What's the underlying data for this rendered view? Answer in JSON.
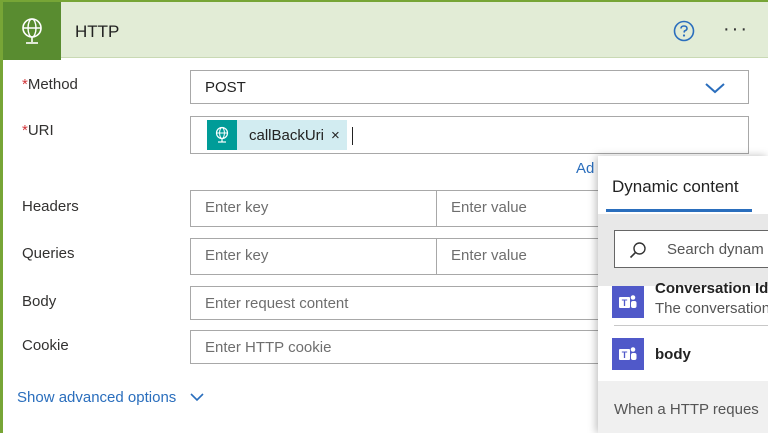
{
  "action": {
    "title": "HTTP",
    "icons": {
      "action": "globe-icon",
      "help": "help-circle-icon",
      "more": "more-options-icon"
    }
  },
  "form": {
    "required_mark": "*",
    "method": {
      "label": "Method",
      "value": "POST"
    },
    "uri": {
      "label": "URI",
      "token_label": "callBackUri",
      "token_close": "×"
    },
    "add_link": "Ad",
    "headers": {
      "label": "Headers",
      "key_placeholder": "Enter key",
      "value_placeholder": "Enter value"
    },
    "queries": {
      "label": "Queries",
      "key_placeholder": "Enter key",
      "value_placeholder": "Enter value"
    },
    "body": {
      "label": "Body",
      "placeholder": "Enter request content"
    },
    "cookie": {
      "label": "Cookie",
      "placeholder": "Enter HTTP cookie"
    },
    "advanced_link": "Show advanced options"
  },
  "dynamic_panel": {
    "title": "Dynamic content",
    "search_placeholder": "Search dynam",
    "items": [
      {
        "title": "Conversation Id",
        "description": "The conversation",
        "icon": "teams-icon"
      },
      {
        "title": "body",
        "description": "",
        "icon": "teams-icon"
      }
    ],
    "footer": "When a HTTP reques"
  },
  "colors": {
    "accent_green": "#77a536",
    "icon_green": "#598c30",
    "header_bg": "#e2ecd6",
    "token_teal": "#009c98",
    "token_bg": "#d2ecf1",
    "link_blue": "#2a6ebd",
    "required_red": "#d13438",
    "teams_purple": "#5059c9"
  }
}
